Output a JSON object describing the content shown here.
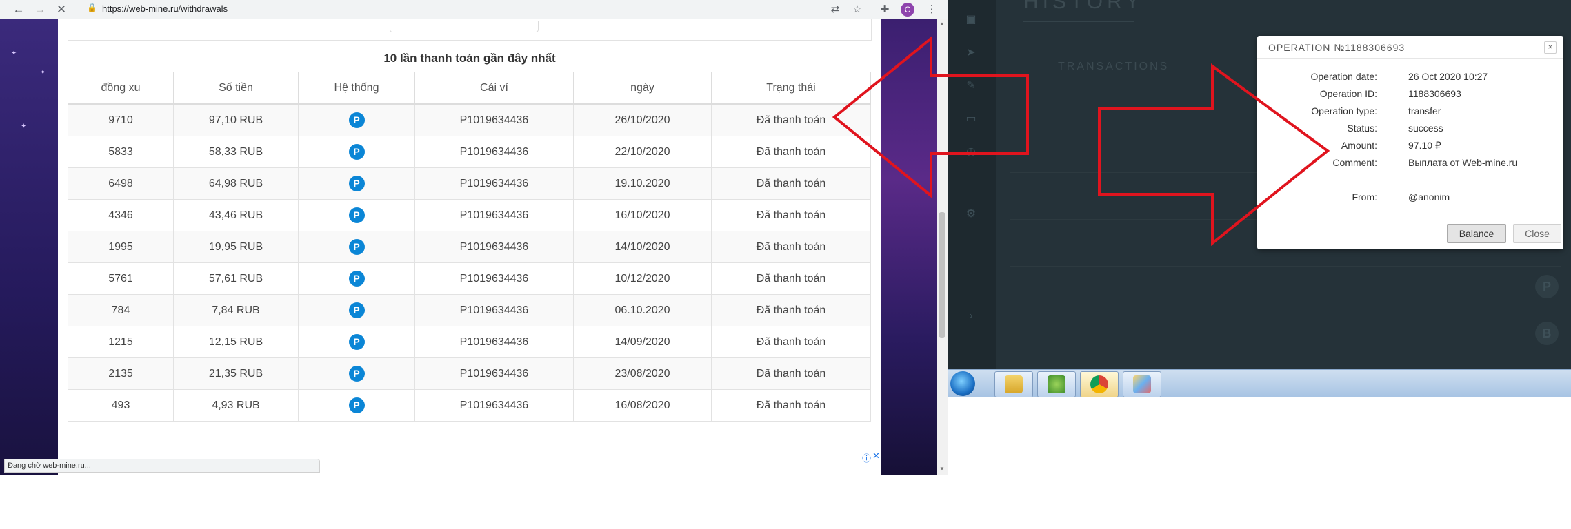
{
  "browser": {
    "url": "https://web-mine.ru/withdrawals",
    "profile_initial": "C",
    "status_text": "Đang chờ web-mine.ru..."
  },
  "withdrawals": {
    "title": "10 lần thanh toán gần đây nhất",
    "columns": [
      "đồng xu",
      "Số tiền",
      "Hệ thống",
      "Cái ví",
      "ngày",
      "Trạng thái"
    ],
    "system_badge": "P",
    "rows": [
      {
        "coins": "9710",
        "amount": "97,10 RUB",
        "wallet": "P1019634436",
        "date": "26/10/2020",
        "status": "Đã thanh toán"
      },
      {
        "coins": "5833",
        "amount": "58,33 RUB",
        "wallet": "P1019634436",
        "date": "22/10/2020",
        "status": "Đã thanh toán"
      },
      {
        "coins": "6498",
        "amount": "64,98 RUB",
        "wallet": "P1019634436",
        "date": "19.10.2020",
        "status": "Đã thanh toán"
      },
      {
        "coins": "4346",
        "amount": "43,46 RUB",
        "wallet": "P1019634436",
        "date": "16/10/2020",
        "status": "Đã thanh toán"
      },
      {
        "coins": "1995",
        "amount": "19,95 RUB",
        "wallet": "P1019634436",
        "date": "14/10/2020",
        "status": "Đã thanh toán"
      },
      {
        "coins": "5761",
        "amount": "57,61 RUB",
        "wallet": "P1019634436",
        "date": "10/12/2020",
        "status": "Đã thanh toán"
      },
      {
        "coins": "784",
        "amount": "7,84 RUB",
        "wallet": "P1019634436",
        "date": "06.10.2020",
        "status": "Đã thanh toán"
      },
      {
        "coins": "1215",
        "amount": "12,15 RUB",
        "wallet": "P1019634436",
        "date": "14/09/2020",
        "status": "Đã thanh toán"
      },
      {
        "coins": "2135",
        "amount": "21,35 RUB",
        "wallet": "P1019634436",
        "date": "23/08/2020",
        "status": "Đã thanh toán"
      },
      {
        "coins": "493",
        "amount": "4,93 RUB",
        "wallet": "P1019634436",
        "date": "16/08/2020",
        "status": "Đã thanh toán"
      }
    ]
  },
  "payeer": {
    "history_title": "HISTORY",
    "transactions_label": "TRANSACTIONS",
    "modal": {
      "title": "OPERATION №1188306693",
      "close_x": "×",
      "fields": [
        {
          "label": "Operation date:",
          "value": "26 Oct 2020 10:27"
        },
        {
          "label": "Operation ID:",
          "value": "1188306693"
        },
        {
          "label": "Operation type:",
          "value": "transfer"
        },
        {
          "label": "Status:",
          "value": "success"
        },
        {
          "label": "Amount:",
          "value": "97.10 ₽"
        },
        {
          "label": "Comment:",
          "value": "Выплата от Web-mine.ru"
        },
        {
          "label": "From:",
          "value": "@anonim"
        }
      ],
      "balance_button": "Balance",
      "close_button": "Close"
    }
  },
  "annotation": {
    "arrow_color": "#e0141e"
  },
  "taskbar": {
    "items": [
      "start-orb-icon",
      "explorer-icon",
      "spotify-icon",
      "chrome-icon",
      "paint-icon"
    ]
  }
}
